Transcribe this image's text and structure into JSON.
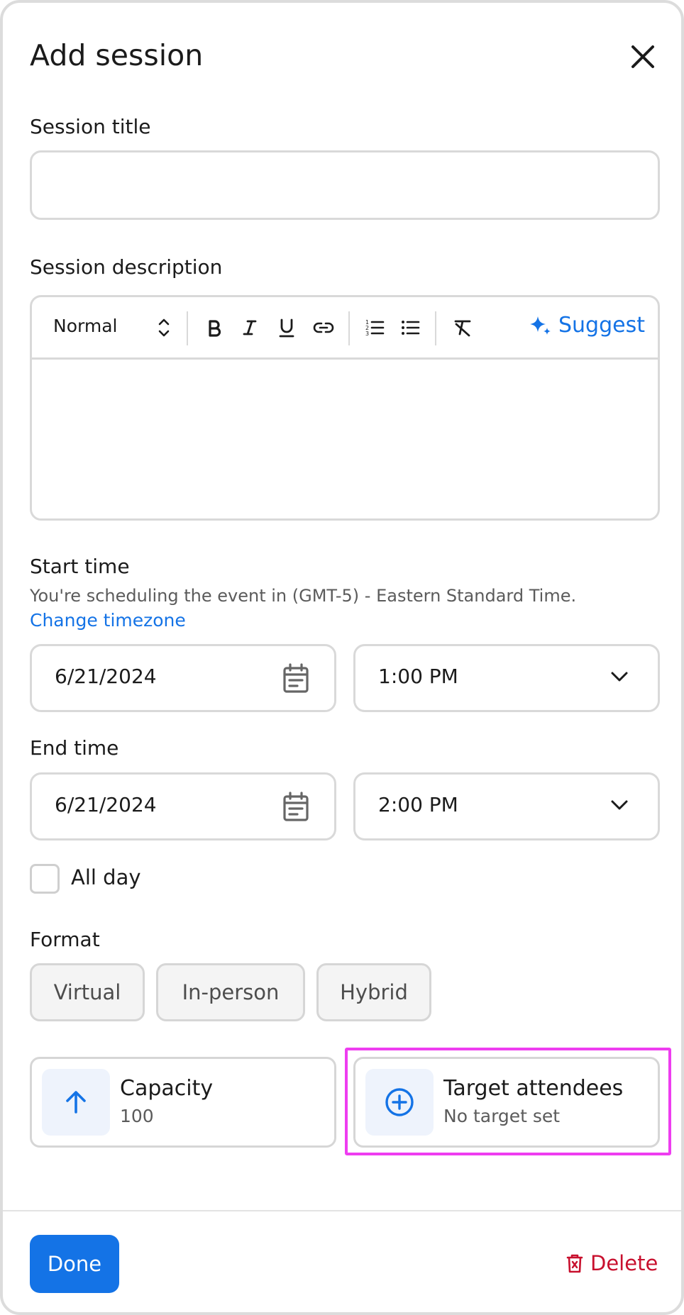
{
  "dialog": {
    "title": "Add session"
  },
  "session_title": {
    "label": "Session title",
    "value": "",
    "placeholder": ""
  },
  "session_description": {
    "label": "Session description",
    "style_select": "Normal",
    "suggest_label": "Suggest",
    "toolbar_icons": [
      "bold-icon",
      "italic-icon",
      "underline-icon",
      "link-icon",
      "numbered-list-icon",
      "bulleted-list-icon",
      "clear-format-icon",
      "sparkle-icon"
    ],
    "value": ""
  },
  "start_time": {
    "label": "Start time",
    "helper": "You're scheduling the event in (GMT-5) - Eastern Standard Time.",
    "change_timezone": "Change timezone",
    "date": "6/21/2024",
    "time": "1:00 PM"
  },
  "end_time": {
    "label": "End time",
    "date": "6/21/2024",
    "time": "2:00 PM"
  },
  "all_day": {
    "label": "All day",
    "checked": false
  },
  "format": {
    "label": "Format",
    "options": [
      "Virtual",
      "In-person",
      "Hybrid"
    ]
  },
  "capacity": {
    "title": "Capacity",
    "value": "100",
    "icon": "arrow-up-icon"
  },
  "target_attendees": {
    "title": "Target attendees",
    "value": "No target set",
    "icon": "plus-circle-icon"
  },
  "footer": {
    "done_label": "Done",
    "delete_label": "Delete"
  },
  "colors": {
    "accent": "#1473e6",
    "danger": "#c8102e",
    "highlight": "#ee3df0"
  }
}
